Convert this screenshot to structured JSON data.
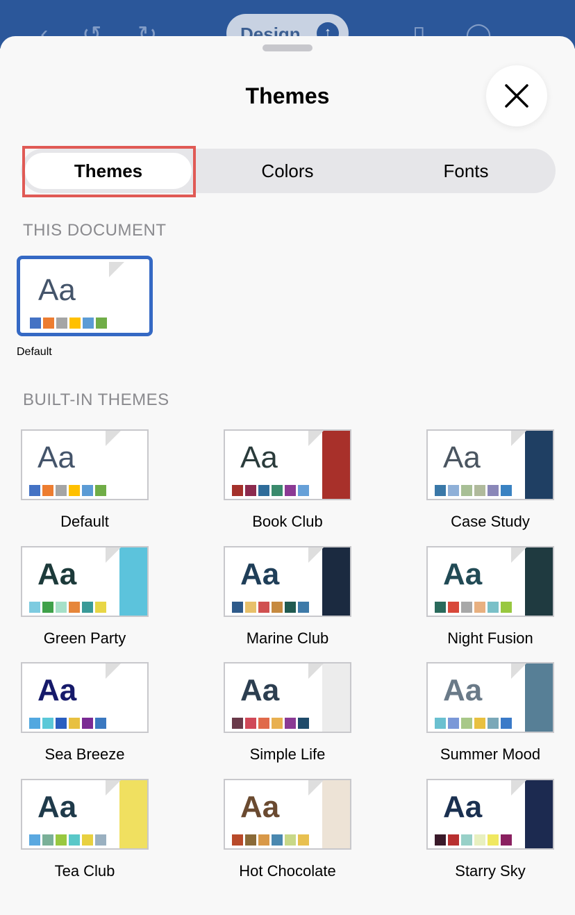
{
  "app_bar": {
    "design_label": "Design"
  },
  "sheet": {
    "title": "Themes"
  },
  "tabs": [
    {
      "label": "Themes",
      "active": true
    },
    {
      "label": "Colors",
      "active": false
    },
    {
      "label": "Fonts",
      "active": false
    }
  ],
  "sections": {
    "this_document": "THIS DOCUMENT",
    "built_in": "BUILT-IN THEMES"
  },
  "document_theme": {
    "name": "Default",
    "aa": "Aa",
    "aa_color": "#44546a",
    "swatches": [
      "#4472c4",
      "#ed7d31",
      "#a5a5a5",
      "#ffc000",
      "#5b9bd5",
      "#70ad47"
    ]
  },
  "built_in_themes": [
    {
      "name": "Default",
      "aa": "Aa",
      "aa_color": "#44546a",
      "swatches": [
        "#4472c4",
        "#ed7d31",
        "#a5a5a5",
        "#ffc000",
        "#5b9bd5",
        "#70ad47"
      ],
      "side": "#ffffff"
    },
    {
      "name": "Book Club",
      "aa": "Aa",
      "aa_color": "#2a3b3b",
      "swatches": [
        "#a4312b",
        "#8b2a4e",
        "#2f6c9a",
        "#3a8a6c",
        "#8b3a94",
        "#66a0d8"
      ],
      "side": "#a8302a"
    },
    {
      "name": "Case Study",
      "aa": "Aa",
      "aa_color": "#4a5560",
      "swatches": [
        "#3a78a8",
        "#8fb0d8",
        "#a8bf96",
        "#b0ba9c",
        "#8a87b8",
        "#3a82c2"
      ],
      "side": "#1f3f63"
    },
    {
      "name": "Green Party",
      "aa": "Aa",
      "aa_color": "#1c3a3a",
      "swatches": [
        "#7dcbe0",
        "#3fa14a",
        "#a6e0c8",
        "#e6863a",
        "#3a9a98",
        "#e8d646"
      ],
      "side": "#5cc3dc"
    },
    {
      "name": "Marine Club",
      "aa": "Aa",
      "aa_color": "#1f3e58",
      "swatches": [
        "#2e5a8a",
        "#e8c06a",
        "#d05050",
        "#c68a40",
        "#205a50",
        "#3e7aa8"
      ],
      "side": "#1b2a40"
    },
    {
      "name": "Night Fusion",
      "aa": "Aa",
      "aa_color": "#214a55",
      "swatches": [
        "#2a6a5c",
        "#d8483a",
        "#a8a8a8",
        "#e8b080",
        "#7ac0c8",
        "#98c840"
      ],
      "side": "#1f3a40"
    },
    {
      "name": "Sea Breeze",
      "aa": "Aa",
      "aa_color": "#161a6a",
      "swatches": [
        "#52a8e0",
        "#5ac8d8",
        "#2a5ec0",
        "#e8c040",
        "#7a2a94",
        "#3a78c0"
      ],
      "side": "#ffffff"
    },
    {
      "name": "Simple Life",
      "aa": "Aa",
      "aa_color": "#2c3e50",
      "swatches": [
        "#6a3a4a",
        "#d04858",
        "#e06a4a",
        "#e8b050",
        "#8a3a94",
        "#1e4a6a"
      ],
      "side": "#ececec"
    },
    {
      "name": "Summer Mood",
      "aa": "Aa",
      "aa_color": "#6a7a88",
      "swatches": [
        "#6ac0d0",
        "#7a98d8",
        "#a8c888",
        "#e8c040",
        "#7aa8b8",
        "#3a7ac8"
      ],
      "side": "#577f96"
    },
    {
      "name": "Tea Club",
      "aa": "Aa",
      "aa_color": "#1f3a4a",
      "swatches": [
        "#5aa8e0",
        "#7ab098",
        "#98c840",
        "#5ac8c8",
        "#e8d040",
        "#9ab0c0"
      ],
      "side": "#f0e060"
    },
    {
      "name": "Hot Chocolate",
      "aa": "Aa",
      "aa_color": "#6a4a30",
      "swatches": [
        "#b84a2a",
        "#8a6a38",
        "#d89848",
        "#4a88b0",
        "#c8d888",
        "#e8c050"
      ],
      "side": "#ede3d6"
    },
    {
      "name": "Starry Sky",
      "aa": "Aa",
      "aa_color": "#1a3050",
      "swatches": [
        "#3a1a2a",
        "#b83030",
        "#98d0c8",
        "#e8f0c0",
        "#f0e860",
        "#8a2060"
      ],
      "side": "#1c2a50"
    }
  ]
}
